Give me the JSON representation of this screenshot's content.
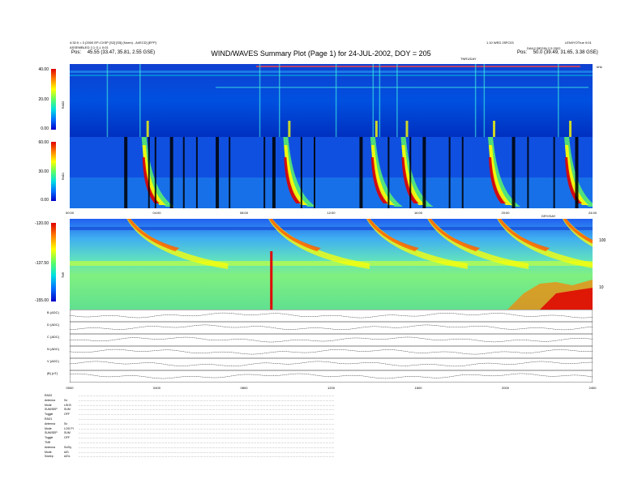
{
  "header": {
    "left_line1": "4:32:0 = 3 (2000 EP-CXSP  [S2] [S5]  (Norm) - AI/ECD] [EFP]",
    "left_line2": "ASSEMBLED 2.1 G-L 0:01",
    "left_pos_label": "Pos:",
    "left_pos_value": "45.55 (33.47, 35.81, 2.55 GSE)",
    "right_line1": "1.10 WED 25FC03",
    "right_line2": "LEN/IYOTrue 0:01",
    "right_line3": "DAILY  BEGIN 2.5  2002",
    "right_pos_label": "Pos:",
    "right_pos_value": "50.0 (39.49, 31.65, 3.38 GSE)",
    "r1_marker": "TNR1/DAY",
    "units_right": "kHz"
  },
  "title": "WIND/WAVES Summary Plot (Page 1) for 24-JUL-2002, DOY = 205",
  "panels": {
    "rad2": {
      "label": "RAD2",
      "ticks": [
        "40.00",
        "20.00",
        "0.00"
      ]
    },
    "rad1": {
      "label": "RAD1",
      "ticks": [
        "60.00",
        "30.00",
        "0.00"
      ]
    },
    "tnr": {
      "label": "TNR",
      "ticks": [
        "-120.00",
        "-137.50",
        "-155.00"
      ],
      "right_ticks": [
        "100",
        "10"
      ],
      "marker": "DRY/DAY"
    }
  },
  "time_ticks": [
    "00:00",
    "04:00",
    "08:00",
    "12:00",
    "16:00",
    "20:00",
    "24:00"
  ],
  "bottom_ticks": [
    "0000",
    "0400",
    "0800",
    "1200",
    "1600",
    "2000",
    "2400"
  ],
  "aux_labels": [
    "B (ADC)",
    "D (ADC)",
    "C (ADC)",
    "N (ADC)",
    "V (ADC)",
    "|B| (nT)"
  ],
  "footer": [
    {
      "k": "RAD2",
      "v": ""
    },
    {
      "k": "Antenna",
      "v": "Sz"
    },
    {
      "k": "Mode",
      "v": "LIN B"
    },
    {
      "k": "SUM/SEP",
      "v": "SUM"
    },
    {
      "k": "Toggle",
      "v": "OFF"
    },
    {
      "k": "RAD1",
      "v": ""
    },
    {
      "k": "Antenna",
      "v": "Sx"
    },
    {
      "k": "Mode",
      "v": "LOG PI"
    },
    {
      "k": "SUM/SEP",
      "v": "SUM"
    },
    {
      "k": "Toggle",
      "v": "OFF"
    },
    {
      "k": "TNR",
      "v": ""
    },
    {
      "k": "Antenna",
      "v": "Sx/Sy"
    },
    {
      "k": "Mode",
      "v": "A/D"
    },
    {
      "k": "Sweep",
      "v": "A/DL"
    }
  ],
  "chart_data": {
    "type": "heatmap",
    "title": "WIND/WAVES Summary Plot (Page 1) for 24-JUL-2002, DOY = 205",
    "x_range_hours": [
      0,
      24
    ],
    "bursts_hours": [
      3.3,
      9.8,
      13.8,
      15.2,
      19.2,
      22.7
    ],
    "colors": [
      "#0000c8",
      "#0070ff",
      "#00e0e0",
      "#60ff60",
      "#ffff00",
      "#ff8000",
      "#e00000"
    ],
    "accent": "#ff0000"
  }
}
